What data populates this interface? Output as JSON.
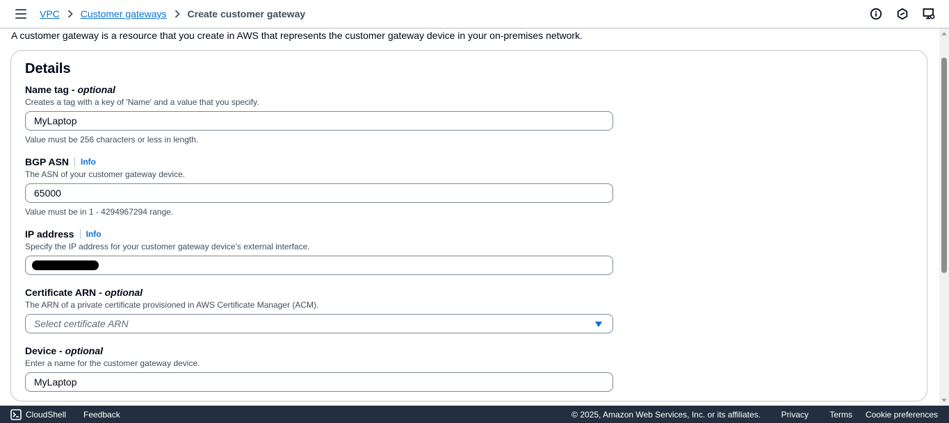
{
  "breadcrumbs": {
    "items": [
      "VPC",
      "Customer gateways"
    ],
    "current": "Create customer gateway"
  },
  "top_icons": [
    "info-icon",
    "notifications-icon",
    "display-settings-icon"
  ],
  "description": "A customer gateway is a resource that you create in AWS that represents the customer gateway device in your on-premises network.",
  "details": {
    "title": "Details",
    "fields": [
      {
        "label": "Name tag",
        "optional": "- optional",
        "description": "Creates a tag with a key of 'Name' and a value that you specify.",
        "value": "MyLaptop",
        "constraint": "Value must be 256 characters or less in length."
      },
      {
        "label": "BGP ASN",
        "info": "Info",
        "description": "The ASN of your customer gateway device.",
        "value": "65000",
        "constraint": "Value must be in 1 - 4294967294 range."
      },
      {
        "label": "IP address",
        "info": "Info",
        "description": "Specify the IP address for your customer gateway device's external interface.",
        "value": ""
      },
      {
        "label": "Certificate ARN",
        "optional": "- optional",
        "description": "The ARN of a private certificate provisioned in AWS Certificate Manager (ACM).",
        "placeholder": "Select certificate ARN"
      },
      {
        "label": "Device",
        "optional": "- optional",
        "description": "Enter a name for the customer gateway device.",
        "value": "MyLaptop"
      }
    ]
  },
  "footer": {
    "cloudshell": "CloudShell",
    "feedback": "Feedback",
    "copyright": "© 2025, Amazon Web Services, Inc. or its affiliates.",
    "privacy": "Privacy",
    "terms": "Terms",
    "cookies": "Cookie preferences"
  },
  "colors": {
    "link": "#0972d3",
    "footer_bg": "#232f3e",
    "text": "#000716",
    "muted_text": "#414d5c"
  }
}
